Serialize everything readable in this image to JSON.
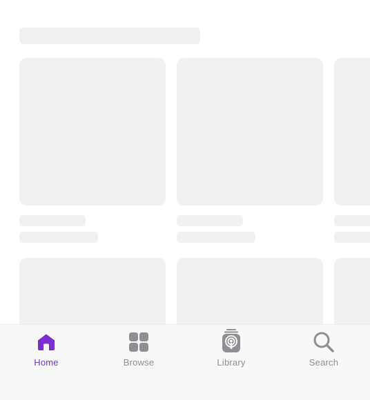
{
  "tabs": [
    {
      "label": "Home",
      "icon": "home-icon",
      "active": true
    },
    {
      "label": "Browse",
      "icon": "grid-icon",
      "active": false
    },
    {
      "label": "Library",
      "icon": "podcast-library-icon",
      "active": false
    },
    {
      "label": "Search",
      "icon": "search-icon",
      "active": false
    }
  ],
  "colors": {
    "accent": "#7b2fd0",
    "inactive": "#8e8e93",
    "skeleton": "#f1f1f1"
  }
}
